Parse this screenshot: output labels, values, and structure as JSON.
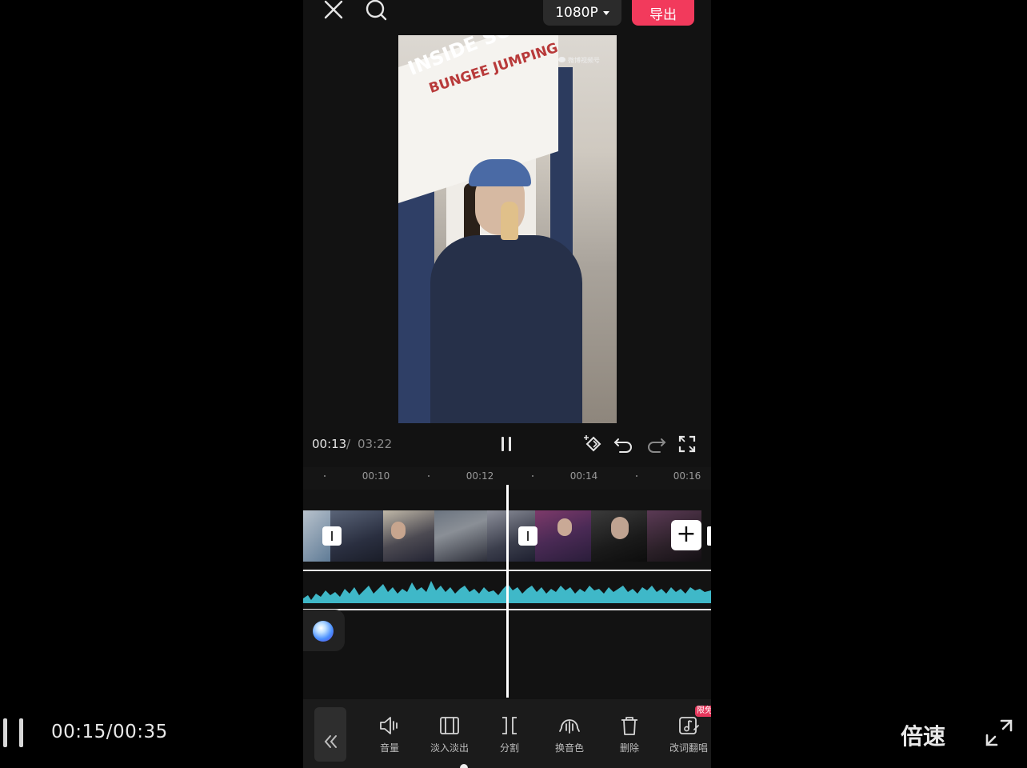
{
  "app": {
    "resolution_label": "1080P",
    "export_label": "导出"
  },
  "preview": {
    "sign_text": "BUNGEE JUMPING",
    "sign_text_top": "INSIDE SOLD H",
    "watermark": "微博视频号"
  },
  "playback": {
    "current_time": "00:13",
    "separator": "/",
    "total_time": "03:22"
  },
  "timeline": {
    "ruler_labels": [
      "00:10",
      "00:12",
      "00:14",
      "00:16"
    ]
  },
  "toolbar": {
    "tools": [
      {
        "label": "音量",
        "icon": "volume-icon"
      },
      {
        "label": "淡入淡出",
        "icon": "fade-icon"
      },
      {
        "label": "分割",
        "icon": "split-icon"
      },
      {
        "label": "换音色",
        "icon": "voice-change-icon"
      },
      {
        "label": "删除",
        "icon": "trash-icon"
      },
      {
        "label": "改词翻唱",
        "icon": "music-edit-icon"
      }
    ],
    "badge": "限免"
  },
  "player": {
    "time": "00:15/00:35",
    "speed_label": "倍速"
  },
  "colors": {
    "export_button": "#f23a5c",
    "waveform": "#3fb8c8",
    "background": "#121212"
  }
}
